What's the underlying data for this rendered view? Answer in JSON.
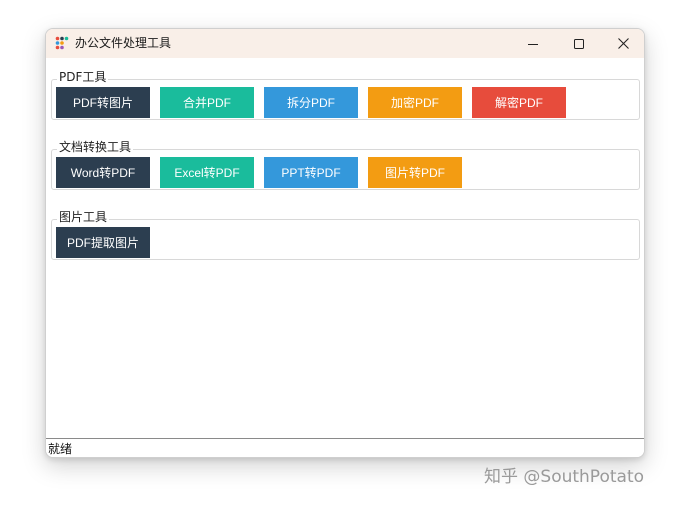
{
  "window": {
    "title": "办公文件处理工具",
    "icon": "app-dots-icon",
    "controls": {
      "minimize": "minimize-icon",
      "maximize": "maximize-icon",
      "close": "close-icon"
    }
  },
  "groups": [
    {
      "title": "PDF工具",
      "buttons": [
        {
          "label": "PDF转图片",
          "color": "#2c3e50"
        },
        {
          "label": "合并PDF",
          "color": "#1abc9c"
        },
        {
          "label": "拆分PDF",
          "color": "#3498db"
        },
        {
          "label": "加密PDF",
          "color": "#f39c12"
        },
        {
          "label": "解密PDF",
          "color": "#e74c3c"
        }
      ]
    },
    {
      "title": "文档转换工具",
      "buttons": [
        {
          "label": "Word转PDF",
          "color": "#2c3e50"
        },
        {
          "label": "Excel转PDF",
          "color": "#1abc9c"
        },
        {
          "label": "PPT转PDF",
          "color": "#3498db"
        },
        {
          "label": "图片转PDF",
          "color": "#f39c12"
        }
      ]
    },
    {
      "title": "图片工具",
      "buttons": [
        {
          "label": "PDF提取图片",
          "color": "#2c3e50"
        }
      ]
    }
  ],
  "status": {
    "text": "就绪"
  },
  "watermark": {
    "text": "知乎 @SouthPotato"
  }
}
